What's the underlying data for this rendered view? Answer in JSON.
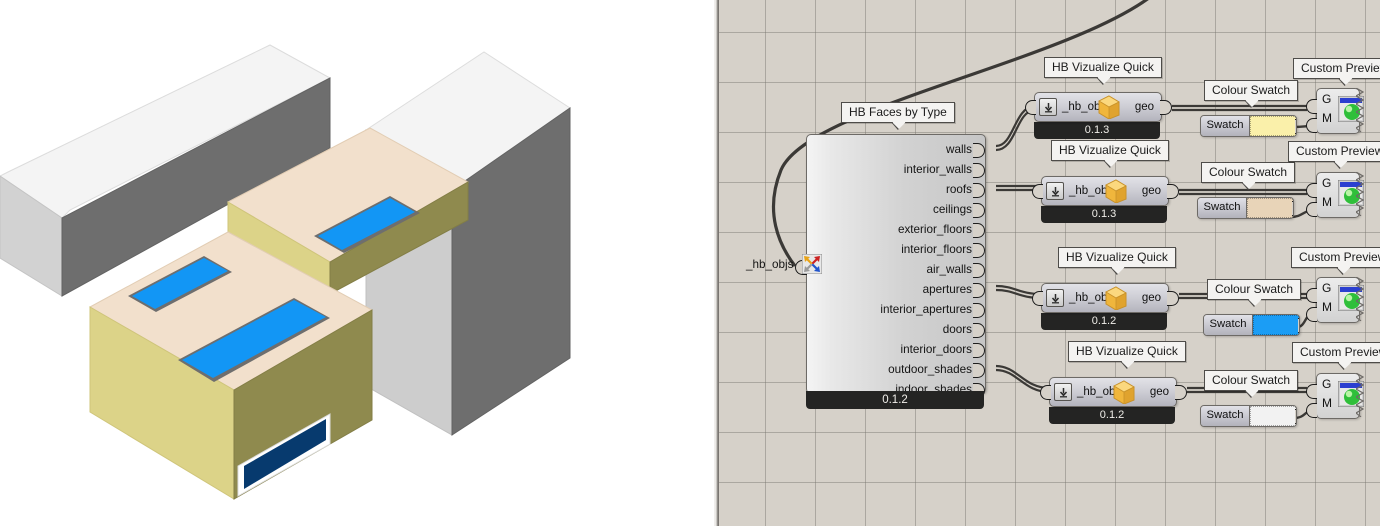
{
  "viewport": {
    "name": "rhino-3d-viewport",
    "background": "#ffffff",
    "geometry_note": "Honeybee model shaded by face type",
    "colors": {
      "wall_exterior": "#f2e0cc",
      "wall_shaded": "#b3ad66",
      "wall_dark": "#8f8a4e",
      "roof_white": "#f4f4f4",
      "roof_grey": "#6e6e6e",
      "roof_light_grey": "#c9c9c9",
      "aperture_blue": "#1296f5",
      "aperture_frame": "#6e6e6e",
      "door_navy": "#073a6e",
      "door_frame": "#ffffff"
    }
  },
  "canvas": {
    "background": "#d6d1c9",
    "grid_color": "#78746e",
    "grid_spacing": 50
  },
  "nodes": {
    "faces_by_type": {
      "label": "HB Faces by Type",
      "input_label": "_hb_objs",
      "input_icon": "graft-flatten-icon",
      "version": "0.1.2",
      "outputs": [
        "walls",
        "interior_walls",
        "roofs",
        "ceilings",
        "exterior_floors",
        "interior_floors",
        "air_walls",
        "apertures",
        "interior_apertures",
        "doors",
        "interior_doors",
        "outdoor_shades",
        "indoor_shades"
      ]
    },
    "vizualize_quick": [
      {
        "label": "HB Vizualize Quick",
        "input_label": "_hb_objs",
        "output_label": "geo",
        "version": "0.1.3",
        "icon": "house-geometry-icon",
        "download_icon": "download-arrow-icon"
      },
      {
        "label": "HB Vizualize Quick",
        "input_label": "_hb_objs",
        "output_label": "geo",
        "version": "0.1.3",
        "icon": "house-geometry-icon",
        "download_icon": "download-arrow-icon"
      },
      {
        "label": "HB Vizualize Quick",
        "input_label": "_hb_objs",
        "output_label": "geo",
        "version": "0.1.2",
        "icon": "house-geometry-icon",
        "download_icon": "download-arrow-icon"
      },
      {
        "label": "HB Vizualize Quick",
        "input_label": "_hb_objs",
        "output_label": "geo",
        "version": "0.1.2",
        "icon": "house-geometry-icon",
        "download_icon": "download-arrow-icon"
      }
    ],
    "colour_swatch": [
      {
        "label": "Colour Swatch",
        "button_label": "Swatch",
        "colour": "#faf0aa"
      },
      {
        "label": "Colour Swatch",
        "button_label": "Swatch",
        "colour": "#e8d4b8"
      },
      {
        "label": "Colour Swatch",
        "button_label": "Swatch",
        "colour": "#1b9df5"
      },
      {
        "label": "Colour Swatch",
        "button_label": "Swatch",
        "colour": "#f2f2f2"
      }
    ],
    "custom_preview": [
      {
        "label": "Custom Preview",
        "geometry_port": "G",
        "material_port": "M",
        "icon": "preview-sphere-icon"
      },
      {
        "label": "Custom Preview",
        "geometry_port": "G",
        "material_port": "M",
        "icon": "preview-sphere-icon"
      },
      {
        "label": "Custom Preview",
        "geometry_port": "G",
        "material_port": "M",
        "icon": "preview-sphere-icon"
      },
      {
        "label": "Custom Preview",
        "geometry_port": "G",
        "material_port": "M",
        "icon": "preview-sphere-icon"
      }
    ]
  },
  "connections": [
    {
      "from": "walls",
      "to": "vizualize_quick_1"
    },
    {
      "from": "roofs",
      "to": "vizualize_quick_2"
    },
    {
      "from": "apertures",
      "to": "vizualize_quick_3"
    },
    {
      "from": "outdoor_shades",
      "to": "vizualize_quick_4"
    }
  ]
}
